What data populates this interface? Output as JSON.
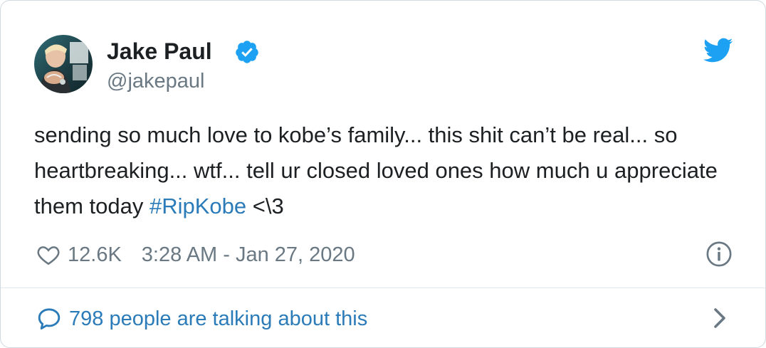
{
  "tweet": {
    "author": {
      "display_name": "Jake Paul",
      "handle": "@jakepaul",
      "verified_icon": "verified-badge-icon",
      "avatar_icon": "avatar-image"
    },
    "brand_icon": "twitter-bird-icon",
    "text": {
      "body": "sending so much love to kobe’s family... this shit can’t be real... so heartbreaking... wtf... tell ur closed loved ones how much u appreciate them today ",
      "hashtag": "#RipKobe",
      "tail": " <\\3"
    },
    "likes": "12.6K",
    "timestamp": "3:28 AM - Jan 27, 2020",
    "talking": "798 people are talking about this",
    "colors": {
      "text": "#1c2022",
      "muted": "#697882",
      "link": "#2b7bb9",
      "twitter_blue": "#1da1f2"
    }
  }
}
